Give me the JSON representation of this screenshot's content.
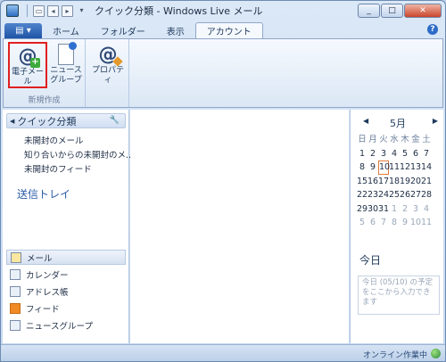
{
  "window": {
    "title": "クイック分類 - Windows Live メール"
  },
  "qat": {
    "icons": [
      "app-icon",
      "new-icon",
      "reply-icon",
      "forward-icon",
      "dropdown-icon"
    ]
  },
  "tabs": [
    {
      "label": "ホーム"
    },
    {
      "label": "フォルダー"
    },
    {
      "label": "表示"
    },
    {
      "label": "アカウント"
    }
  ],
  "ribbon": {
    "group_label": "新規作成",
    "email_label": "電子メール",
    "news_label_1": "ニュース",
    "news_label_2": "グループ",
    "props_label": "プロパティ"
  },
  "left": {
    "quick_header": "クイック分類",
    "quick_items": [
      "未開封のメール",
      "知り合いからの未開封のメ...",
      "未開封のフィード"
    ],
    "outbox": "送信トレイ",
    "nav_items": [
      "メール",
      "カレンダー",
      "アドレス帳",
      "フィード",
      "ニュースグループ"
    ]
  },
  "calendar": {
    "month": "5月",
    "prev": "◀",
    "next": "▶",
    "days_of_week": [
      "日",
      "月",
      "火",
      "水",
      "木",
      "金",
      "土"
    ],
    "weeks": [
      [
        "1",
        "2",
        "3",
        "4",
        "5",
        "6",
        "7"
      ],
      [
        "8",
        "9",
        "10",
        "11",
        "12",
        "13",
        "14"
      ],
      [
        "15",
        "16",
        "17",
        "18",
        "19",
        "20",
        "21"
      ],
      [
        "22",
        "23",
        "24",
        "25",
        "26",
        "27",
        "28"
      ],
      [
        "29",
        "30",
        "31",
        "1",
        "2",
        "3",
        "4"
      ],
      [
        "5",
        "6",
        "7",
        "8",
        "9",
        "10",
        "11"
      ]
    ],
    "today_value": "10",
    "today_title": "今日",
    "today_placeholder": "今日 (05/10) の予定をここから入力できます"
  },
  "status": {
    "text": "オンライン作業中"
  }
}
